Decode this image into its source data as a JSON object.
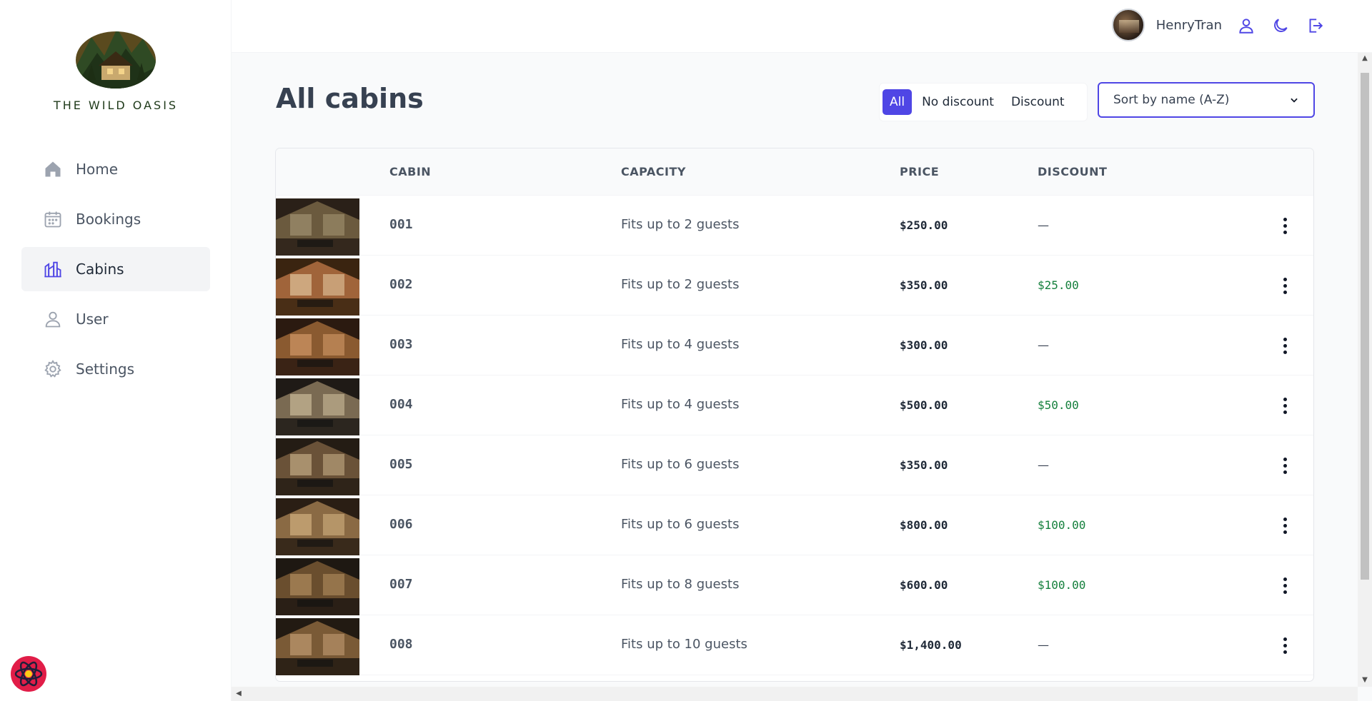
{
  "brand": {
    "name": "THE WILD OASIS"
  },
  "nav": [
    {
      "label": "Home",
      "icon": "home-icon",
      "active": false
    },
    {
      "label": "Bookings",
      "icon": "calendar-icon",
      "active": false
    },
    {
      "label": "Cabins",
      "icon": "cabins-icon",
      "active": true
    },
    {
      "label": "User",
      "icon": "user-icon",
      "active": false
    },
    {
      "label": "Settings",
      "icon": "gear-icon",
      "active": false
    }
  ],
  "header": {
    "username": "HenryTran",
    "icons": [
      "user-icon",
      "moon-icon",
      "logout-icon"
    ]
  },
  "page": {
    "title": "All cabins"
  },
  "filter": {
    "options": [
      "All",
      "No discount",
      "Discount"
    ],
    "active": "All"
  },
  "sort": {
    "selected": "Sort by name (A-Z)"
  },
  "table": {
    "headers": [
      "CABIN",
      "CAPACITY",
      "PRICE",
      "DISCOUNT"
    ],
    "rows": [
      {
        "name": "001",
        "capacity": "Fits up to 2 guests",
        "price": "$250.00",
        "discount": "—"
      },
      {
        "name": "002",
        "capacity": "Fits up to 2 guests",
        "price": "$350.00",
        "discount": "$25.00"
      },
      {
        "name": "003",
        "capacity": "Fits up to 4 guests",
        "price": "$300.00",
        "discount": "—"
      },
      {
        "name": "004",
        "capacity": "Fits up to 4 guests",
        "price": "$500.00",
        "discount": "$50.00"
      },
      {
        "name": "005",
        "capacity": "Fits up to 6 guests",
        "price": "$350.00",
        "discount": "—"
      },
      {
        "name": "006",
        "capacity": "Fits up to 6 guests",
        "price": "$800.00",
        "discount": "$100.00"
      },
      {
        "name": "007",
        "capacity": "Fits up to 8 guests",
        "price": "$600.00",
        "discount": "$100.00"
      },
      {
        "name": "008",
        "capacity": "Fits up to 10 guests",
        "price": "$1,400.00",
        "discount": "—"
      }
    ]
  },
  "colors": {
    "accent": "#4f46e5",
    "discount": "#15803d",
    "brand": "#1f3a1a"
  }
}
